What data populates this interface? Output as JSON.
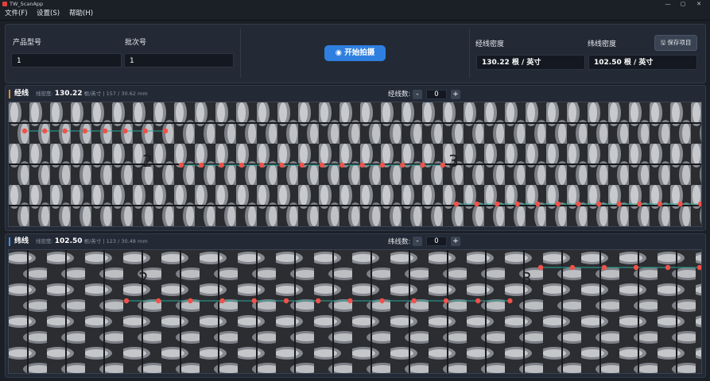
{
  "window": {
    "title": "TW_ScanApp",
    "min": "—",
    "max": "▢",
    "close": "✕"
  },
  "menu": [
    {
      "label": "文件(F)"
    },
    {
      "label": "设置(S)"
    },
    {
      "label": "帮助(H)"
    }
  ],
  "product": {
    "model_label": "产品型号",
    "model_value": "1",
    "batch_label": "批次号",
    "batch_value": "1"
  },
  "actions": {
    "start_label": "开始拍摄",
    "save_label": "保存项目"
  },
  "density": {
    "warp_label": "经线密度",
    "warp_value": "130.22 根 / 英寸",
    "weft_label": "纬线密度",
    "weft_value": "102.50 根 / 英寸"
  },
  "warp_section": {
    "title": "经线",
    "meta_prefix": "线密度:",
    "meta_value": "130.22",
    "meta_suffix": "根/英寸 | 157 / 30.62 mm",
    "count_label": "经线数:",
    "count_value": "0",
    "minus": "-",
    "plus": "+",
    "annotations": [
      "2",
      "3"
    ]
  },
  "weft_section": {
    "title": "纬线",
    "meta_prefix": "线密度:",
    "meta_value": "102.50",
    "meta_suffix": "根/英寸 | 123 / 30.48 mm",
    "count_label": "纬线数:",
    "count_value": "0",
    "minus": "-",
    "plus": "+",
    "annotations": [
      "2",
      "3"
    ]
  },
  "colors": {
    "accent": "#2f7fe0",
    "marker": "#f0524a",
    "trace": "#2aa89a",
    "warp_accent": "#e08a2f",
    "weft_accent": "#3b8ff0"
  }
}
